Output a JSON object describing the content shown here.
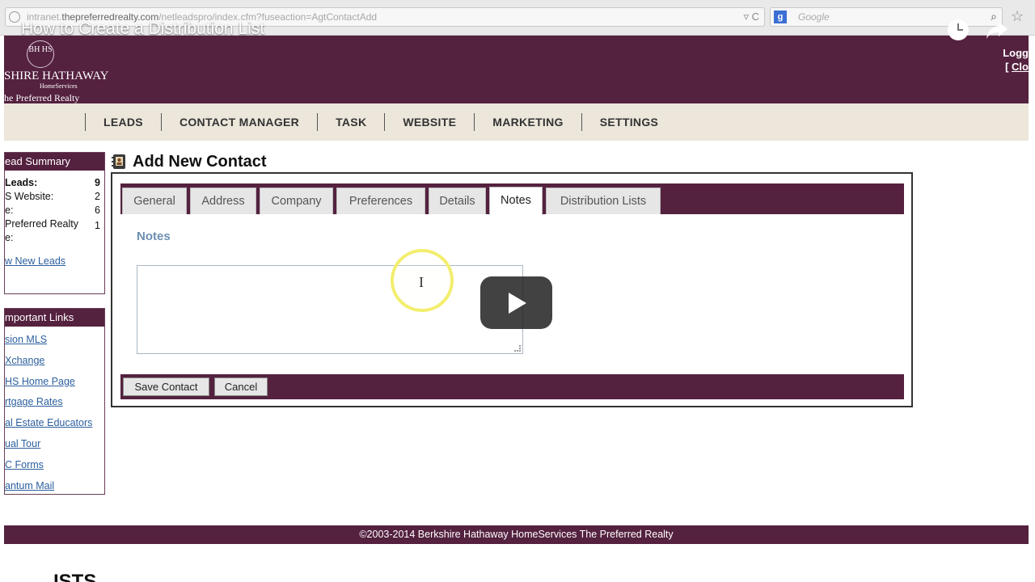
{
  "browser": {
    "url_prefix": "intranet.",
    "url_domain": "thepreferredrealty.com",
    "url_path": "/netleadspro/index.cfm?fuseaction=AgtContactAdd",
    "search_placeholder": "Google"
  },
  "video": {
    "title": "How to Create a Distribution List"
  },
  "header": {
    "seal_text": "BH HS",
    "brand_name": "SHIRE HATHAWAY",
    "brand_sub": "HomeServices",
    "office_name": "he Preferred Realty",
    "logged_text": "Logg",
    "close_bracket": "[",
    "close_link": "Clo"
  },
  "nav": {
    "items": [
      "LEADS",
      "CONTACT MANAGER",
      "TASK",
      "WEBSITE",
      "MARKETING",
      "SETTINGS"
    ]
  },
  "lead_summary": {
    "heading": "ead Summary",
    "rows": [
      {
        "label": " Leads:",
        "value": "9"
      },
      {
        "label": "S Website:",
        "value": "2"
      },
      {
        "label": "e:",
        "value": "6"
      },
      {
        "label": "Preferred Realty",
        "value": "1"
      },
      {
        "label": "e:",
        "value": ""
      }
    ],
    "view_link": "w New Leads"
  },
  "important_links": {
    "heading": "mportant Links",
    "items": [
      "sion MLS",
      "Xchange",
      "HS Home Page",
      "rtgage Rates",
      "al Estate Educators",
      "ual Tour",
      "C Forms",
      "antum Mail"
    ]
  },
  "page": {
    "title": "Add New Contact"
  },
  "tabs": [
    "General",
    "Address",
    "Company",
    "Preferences",
    "Details",
    "Notes",
    "Distribution Lists"
  ],
  "active_tab": "Notes",
  "notes": {
    "section_title": "Notes",
    "value": ""
  },
  "actions": {
    "save_label": "Save Contact",
    "cancel_label": "Cancel"
  },
  "footer": {
    "text": "©2003-2014 Berkshire Hathaway HomeServices The Preferred Realty"
  },
  "bottom": {
    "partial_text": "ISTS"
  },
  "colors": {
    "brand_purple": "#54213f",
    "nav_beige": "#ece6db",
    "link_blue": "#2c5f9e",
    "section_blue": "#6d8fb2",
    "cursor_highlight": "#f2ee6e"
  }
}
